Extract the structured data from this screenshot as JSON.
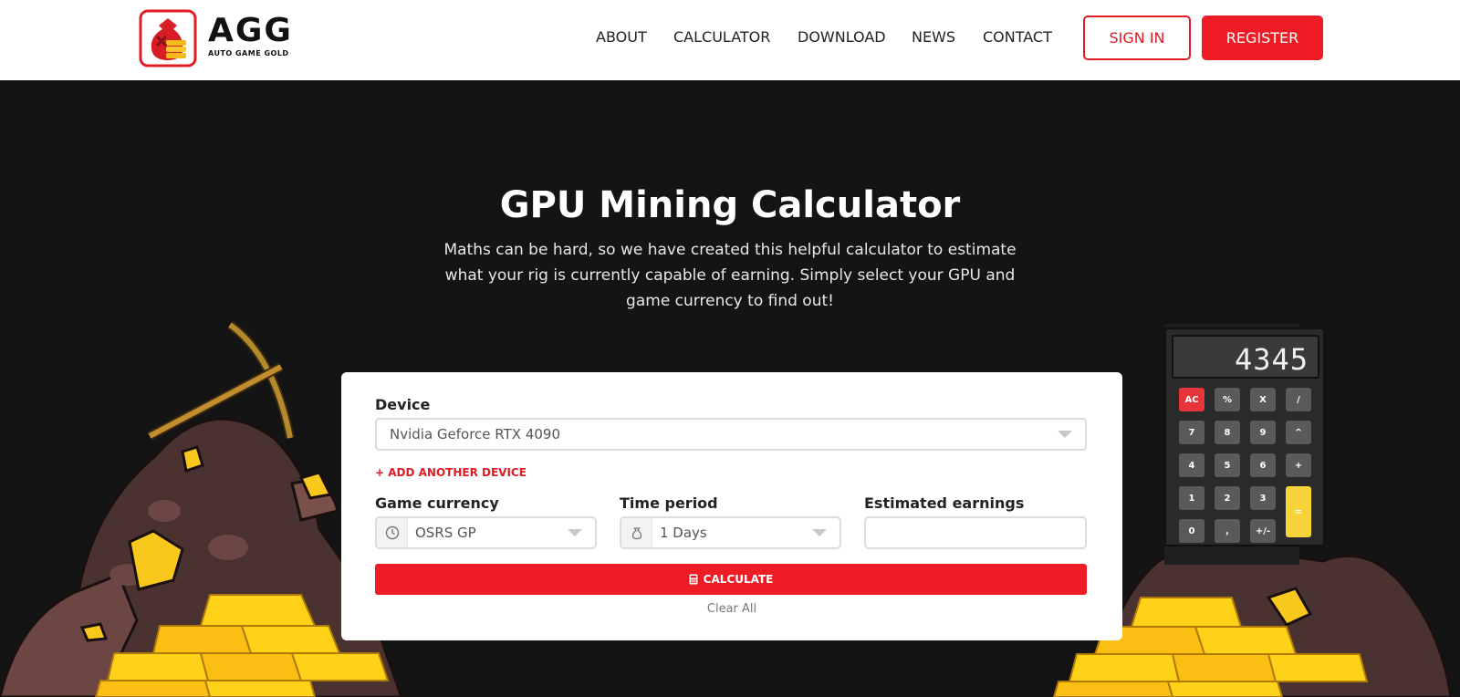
{
  "brand": {
    "name": "AGG",
    "tagline": "AUTO GAME GOLD",
    "accent_color": "#ee1c25"
  },
  "nav": {
    "items": [
      {
        "label": "ABOUT"
      },
      {
        "label": "CALCULATOR"
      },
      {
        "label": "DOWNLOAD"
      },
      {
        "label": "NEWS"
      },
      {
        "label": "CONTACT"
      }
    ],
    "sign_in": "SIGN IN",
    "register": "REGISTER"
  },
  "hero": {
    "title": "GPU Mining Calculator",
    "subtitle": "Maths can be hard, so we have created this helpful calculator to estimate what your rig is currently capable of earning. Simply select your GPU and game currency to find out!"
  },
  "calculator_art": {
    "display": "4345",
    "keys": [
      "AC",
      "%",
      "X",
      "/",
      "7",
      "8",
      "9",
      "^",
      "4",
      "5",
      "6",
      "+",
      "1",
      "2",
      "3",
      "=",
      "0",
      ",",
      "+/-"
    ]
  },
  "form": {
    "device_label": "Device",
    "device_value": "Nvidia Geforce RTX 4090",
    "add_device": "+ ADD ANOTHER DEVICE",
    "currency_label": "Game currency",
    "currency_value": "OSRS GP",
    "currency_icon": "clock-icon",
    "period_label": "Time period",
    "period_value": "1 Days",
    "period_icon": "money-bag-icon",
    "earnings_label": "Estimated earnings",
    "earnings_value": "",
    "calculate": "CALCULATE",
    "calculate_icon": "calculator-icon",
    "clear": "Clear All"
  }
}
